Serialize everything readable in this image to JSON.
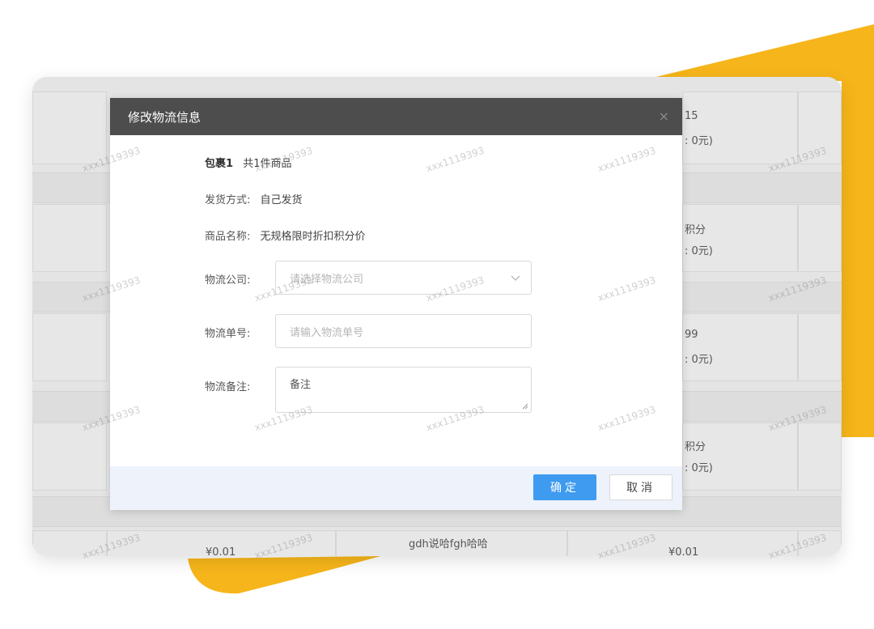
{
  "colors": {
    "accent_yellow": "#f6b51a",
    "ok_blue": "#3e9bf0",
    "header_dark": "#4d4d4d"
  },
  "watermark": "xxx1119393",
  "background_table": {
    "col4_texts": [
      "15",
      ": 0元)",
      "积分",
      ": 0元)",
      "99",
      ": 0元)",
      "积分",
      ": 0元)"
    ],
    "bottom_row": {
      "price_left": "¥0.01",
      "product": "gdh说哈fgh哈哈",
      "price_right": "¥0.01"
    }
  },
  "modal": {
    "title": "修改物流信息",
    "close": "×",
    "package": {
      "name": "包裹1",
      "count": "共1件商品"
    },
    "shipping": {
      "label": "发货方式:",
      "value": "自己发货"
    },
    "product": {
      "label": "商品名称:",
      "value": "无规格限时折扣积分价"
    },
    "company": {
      "label": "物流公司:",
      "placeholder": "请选择物流公司",
      "icon": "chevron-down-icon"
    },
    "number": {
      "label": "物流单号:",
      "placeholder": "请输入物流单号"
    },
    "note": {
      "label": "物流备注:",
      "value": "备注"
    },
    "ok_label": "确定",
    "cancel_label": "取消"
  }
}
